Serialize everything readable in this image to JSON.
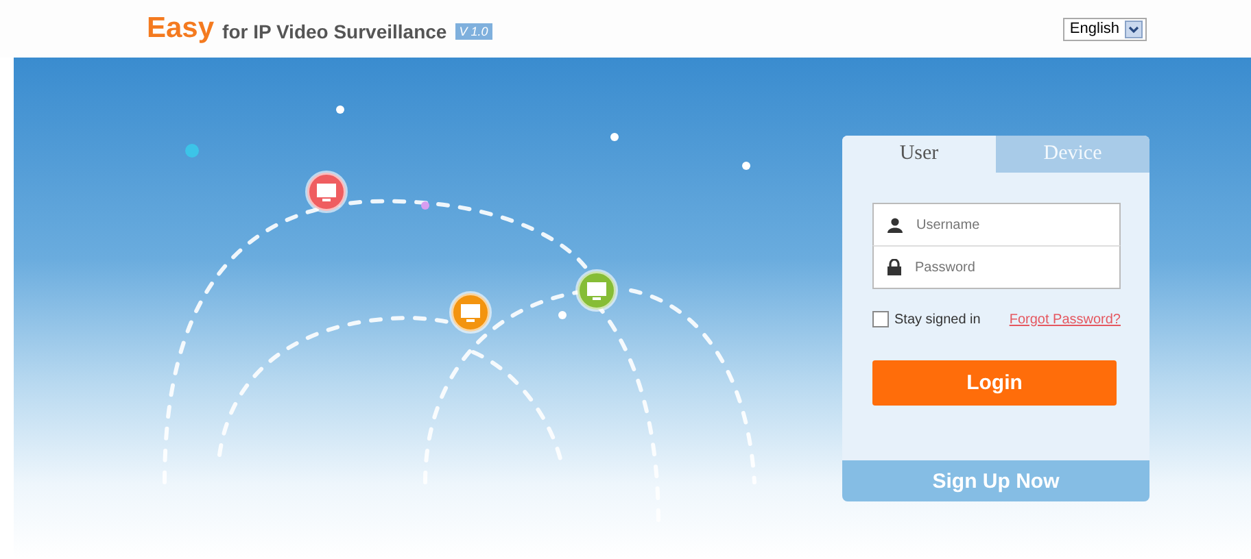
{
  "header": {
    "brand": "Easy",
    "tagline": "for IP Video Surveillance",
    "version": "V 1.0",
    "language": {
      "value": "English"
    }
  },
  "login": {
    "tabs": [
      {
        "label": "User",
        "selected": true
      },
      {
        "label": "Device",
        "selected": false
      }
    ],
    "username": {
      "placeholder": "Username"
    },
    "password": {
      "placeholder": "Password"
    },
    "stay_signed_in": {
      "label": "Stay signed in",
      "checked": false
    },
    "forgot_link": "Forgot Password?",
    "login_button": "Login",
    "signup_button": "Sign Up Now"
  }
}
